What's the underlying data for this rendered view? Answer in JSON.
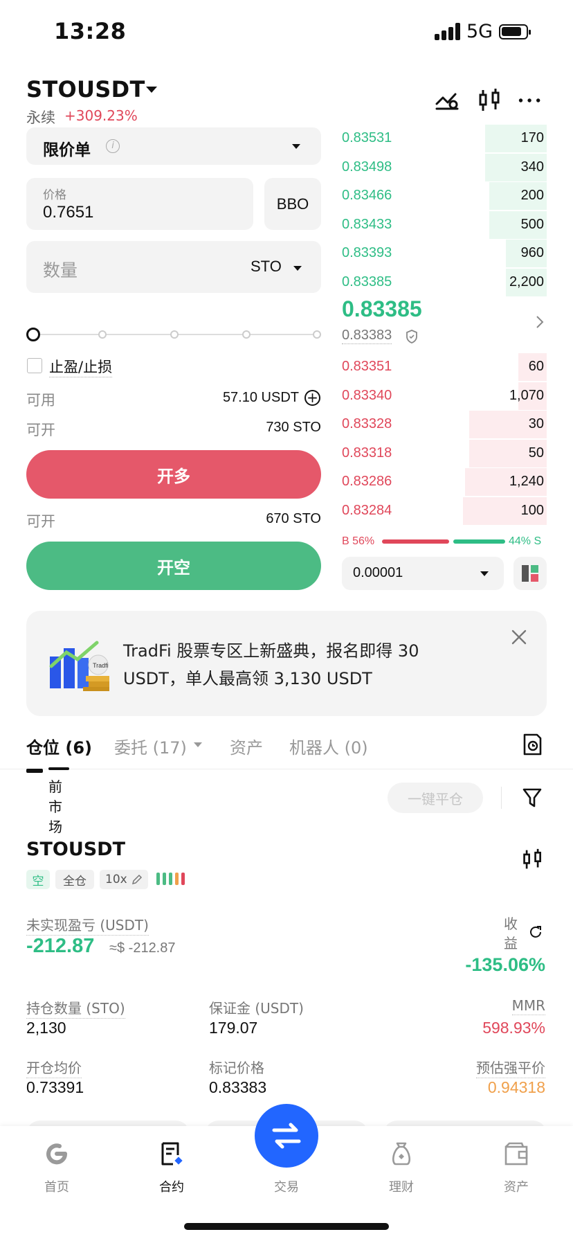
{
  "status": {
    "time": "13:28",
    "network": "5G"
  },
  "header": {
    "pair": "STOUSDT",
    "contract_type": "永续",
    "change": "+309.23%"
  },
  "order_form": {
    "order_type": "限价单",
    "price_label": "价格",
    "price_value": "0.7651",
    "bbo_label": "BBO",
    "quantity_placeholder": "数量",
    "quantity_unit": "STO",
    "slider_level": 0,
    "tpsl_label": "止盈/止损",
    "available_label": "可用",
    "available_value": "57.10 USDT",
    "open_long_label": "可开",
    "open_long_value": "730 STO",
    "long_button": "开多",
    "open_short_label": "可开",
    "open_short_value": "670 STO",
    "short_button": "开空"
  },
  "order_book": {
    "asks": [
      {
        "price": "0.83531",
        "qty": "170",
        "depth": 0.3
      },
      {
        "price": "0.83498",
        "qty": "340",
        "depth": 0.3
      },
      {
        "price": "0.83466",
        "qty": "200",
        "depth": 0.28
      },
      {
        "price": "0.83433",
        "qty": "500",
        "depth": 0.28
      },
      {
        "price": "0.83393",
        "qty": "960",
        "depth": 0.2
      },
      {
        "price": "0.83385",
        "qty": "2,200",
        "depth": 0.2
      }
    ],
    "last_price": "0.83385",
    "mark_price": "0.83383",
    "bids": [
      {
        "price": "0.83351",
        "qty": "60",
        "depth": 0.14
      },
      {
        "price": "0.83340",
        "qty": "1,070",
        "depth": 0.14
      },
      {
        "price": "0.83328",
        "qty": "30",
        "depth": 0.38
      },
      {
        "price": "0.83318",
        "qty": "50",
        "depth": 0.38
      },
      {
        "price": "0.83286",
        "qty": "1,240",
        "depth": 0.4
      },
      {
        "price": "0.83284",
        "qty": "100",
        "depth": 0.41
      }
    ],
    "buy_ratio": "B 56%",
    "sell_ratio": "44% S",
    "buy_fraction": 0.56,
    "precision": "0.00001"
  },
  "banner": {
    "text": "TradFi 股票专区上新盛典，报名即得 30 USDT，单人最高领 3,130 USDT"
  },
  "tabs": [
    {
      "label": "仓位 (6)"
    },
    {
      "label": "委托 (17)"
    },
    {
      "label": "资产"
    },
    {
      "label": "机器人 (0)"
    }
  ],
  "positions": {
    "filter_label": "前市场",
    "close_all_label": "一键平仓",
    "symbol": "STOUSDT",
    "side": "空",
    "margin_mode": "全仓",
    "leverage": "10x",
    "unrealized_label": "未实现盈亏 (USDT)",
    "unrealized_value": "-212.87",
    "unrealized_approx": "≈$ -212.87",
    "roi_label": "收益",
    "roi_value": "-135.06%",
    "size_label": "持仓数量 (STO)",
    "size_value": "2,130",
    "margin_label": "保证金 (USDT)",
    "margin_value": "179.07",
    "mmr_label": "MMR",
    "mmr_value": "598.93%",
    "entry_label": "开仓均价",
    "entry_value": "0.73391",
    "mark_label": "标记价格",
    "mark_value": "0.83383",
    "liq_label": "预估强平价",
    "liq_value": "0.94318"
  },
  "bottom_nav": [
    {
      "label": "首页"
    },
    {
      "label": "合约"
    },
    {
      "label": "交易"
    },
    {
      "label": "理财"
    },
    {
      "label": "资产"
    }
  ],
  "colors": {
    "green": "#2ebd85",
    "red": "#e0475a",
    "blue": "#2266ff",
    "orange": "#f0a04b"
  }
}
